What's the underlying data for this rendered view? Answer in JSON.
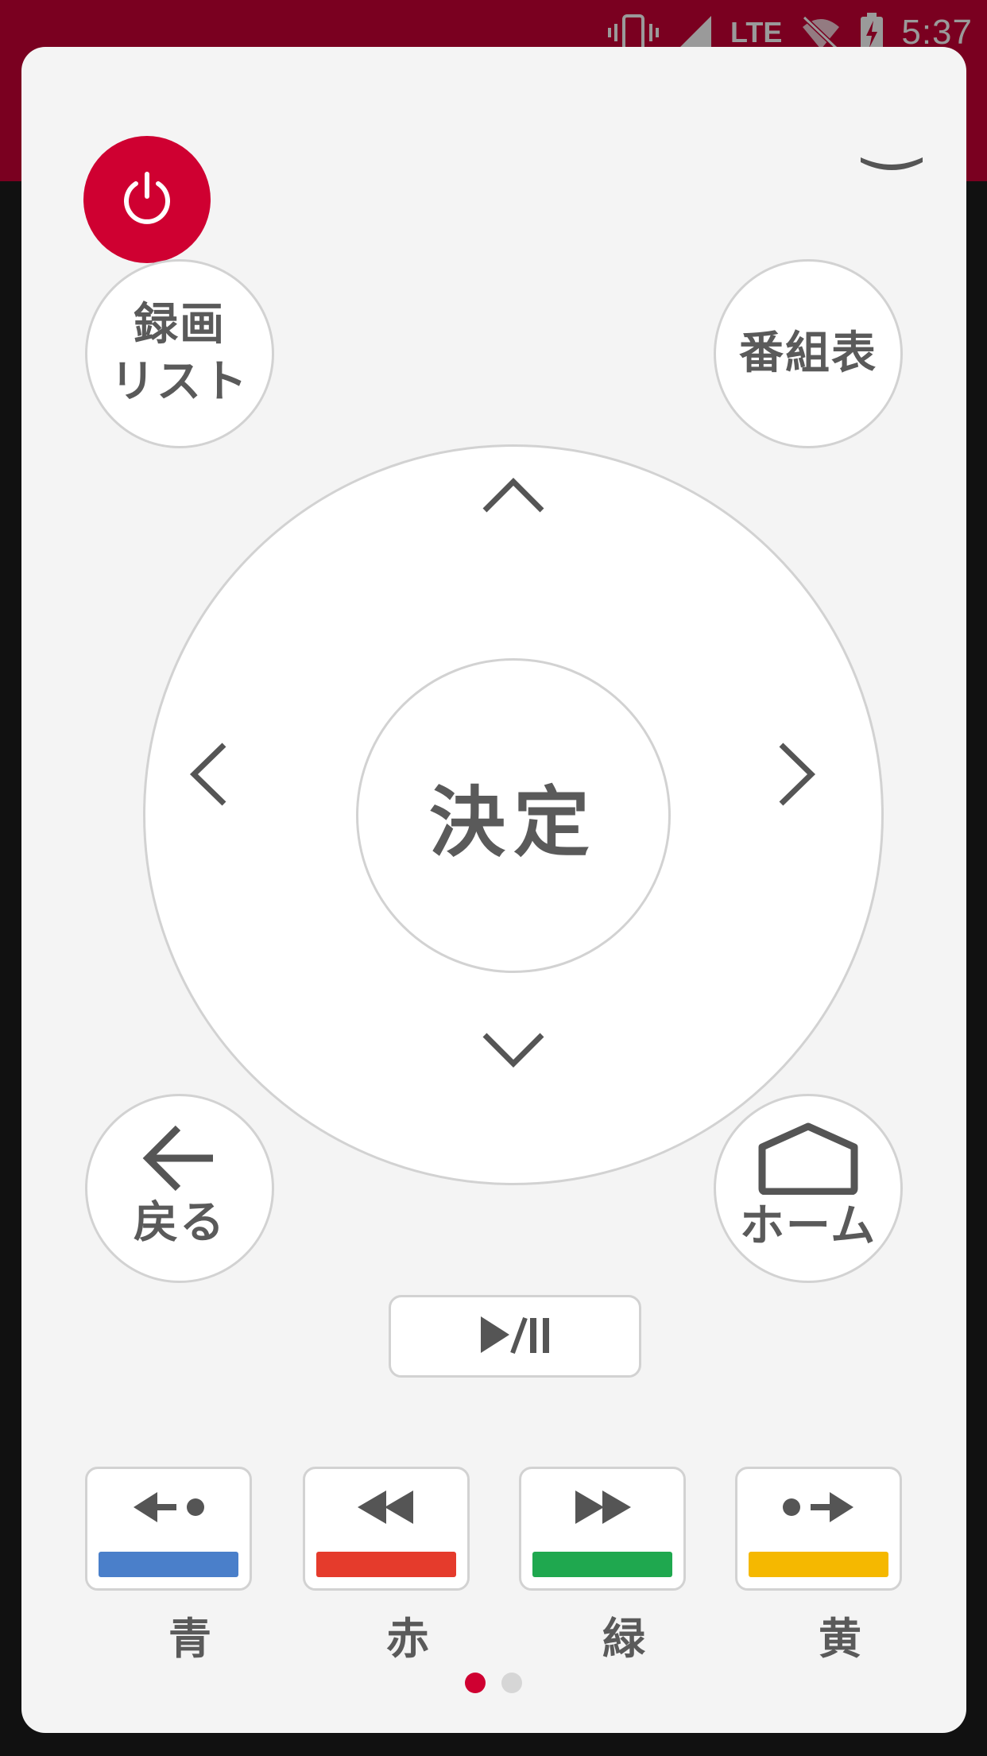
{
  "status_bar": {
    "time": "5:37",
    "network": "LTE",
    "icons": [
      "vibrate-icon",
      "signal-icon",
      "wifi-off-icon",
      "battery-charging-icon"
    ]
  },
  "theme": {
    "header_color": "#7a0020",
    "accent_color": "#cf0031",
    "panel_color": "#f4f4f4"
  },
  "remote": {
    "power_icon": "power-icon",
    "collapse_icon": "chevron-down-icon",
    "recording_list": {
      "line1": "録画",
      "line2": "リスト"
    },
    "program_guide": {
      "label": "番組表"
    },
    "dpad": {
      "ok_label": "決定",
      "icons": [
        "chevron-up-icon",
        "chevron-down-icon",
        "chevron-left-icon",
        "chevron-right-icon"
      ]
    },
    "back": {
      "label": "戻る",
      "icon": "arrow-left-icon"
    },
    "home": {
      "label": "ホーム",
      "icon": "home-icon"
    },
    "play_pause": {
      "icon": "play-pause-icon"
    },
    "color_buttons": [
      {
        "label": "青",
        "color": "#4a7fca",
        "icon": "skip-back-icon"
      },
      {
        "label": "赤",
        "color": "#e53b2c",
        "icon": "rewind-icon"
      },
      {
        "label": "緑",
        "color": "#1fa84f",
        "icon": "fast-forward-icon"
      },
      {
        "label": "黄",
        "color": "#f5b800",
        "icon": "skip-forward-icon"
      }
    ]
  },
  "pager": {
    "page_count": 2,
    "current_page": 1,
    "active_color": "#cf0031",
    "inactive_color": "#d6d6d6"
  }
}
